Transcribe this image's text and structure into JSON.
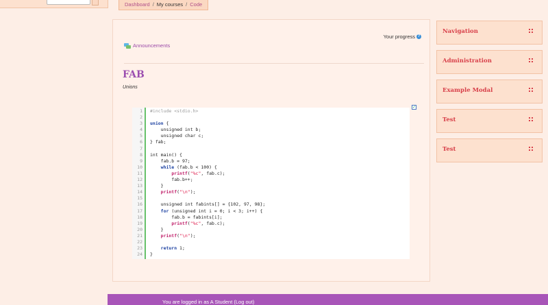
{
  "breadcrumb": [
    {
      "label": "Dashboard",
      "link": true
    },
    {
      "label": "My courses",
      "link": false
    },
    {
      "label": "Code",
      "link": true
    }
  ],
  "main": {
    "progress_label": "Your progress",
    "announcements_label": "Announcements",
    "title": "FAB",
    "subtitle": "Unions",
    "code_lines": [
      "#include <stdio.h>",
      "",
      "union {",
      "    unsigned int b;",
      "    unsigned char c;",
      "} fab;",
      "",
      "int main() {",
      "    fab.b = 97;",
      "    while (fab.b < 100) {",
      "        printf(\"%c\", fab.c);",
      "        fab.b++;",
      "    }",
      "    printf(\"\\n\");",
      "",
      "    unsigned int fabints[] = {102, 97, 98};",
      "    for (unsigned int i = 0; i < 3; i++) {",
      "        fab.b = fabints[i];",
      "        printf(\"%c\", fab.c);",
      "    }",
      "    printf(\"\\n\");",
      "",
      "    return 1;",
      "}"
    ]
  },
  "blocks": [
    "Navigation",
    "Administration",
    "Example Modal",
    "Test",
    "Test"
  ],
  "footer": {
    "text": "You are logged in as A Student (Log out)"
  },
  "colors": {
    "accent": "#a855b8",
    "block_title": "#d8404a",
    "title": "#9c4fb0"
  },
  "icons": [
    "help-icon",
    "forum-icon",
    "completion-check-icon",
    "move-icon"
  ]
}
